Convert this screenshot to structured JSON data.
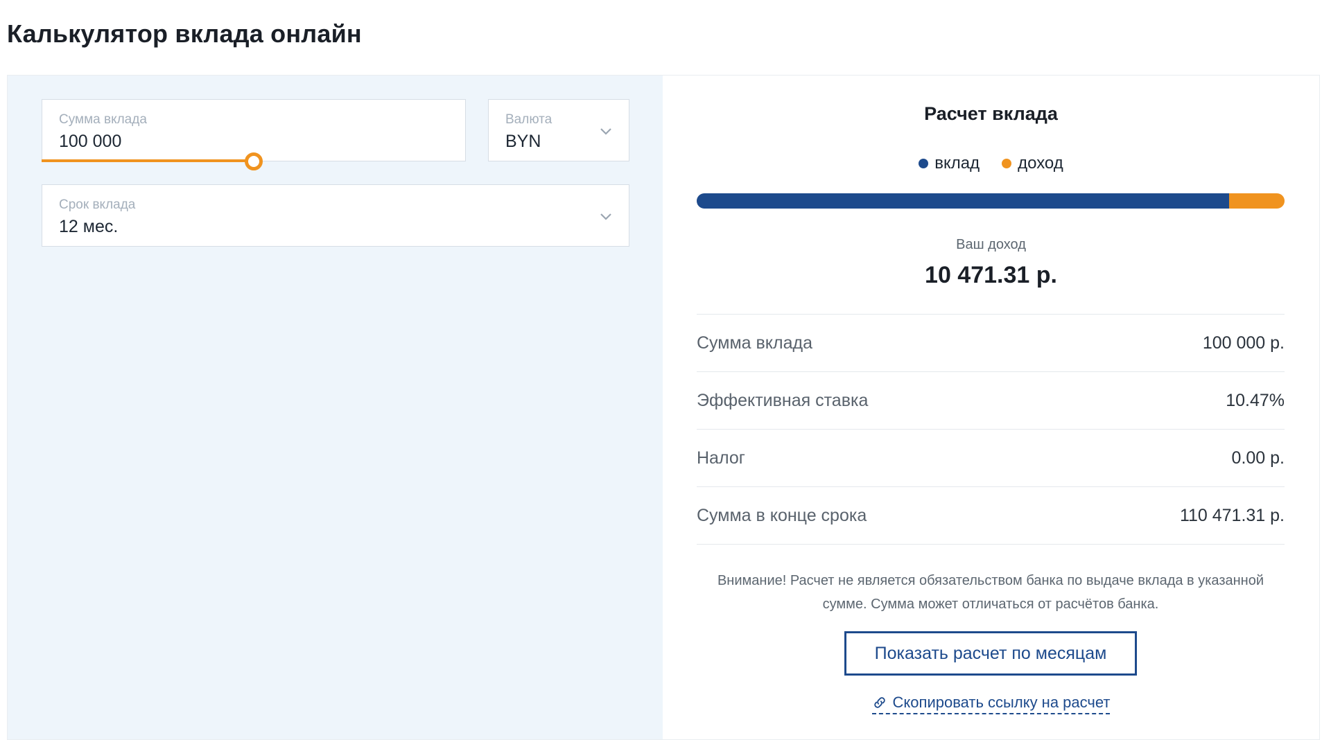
{
  "page": {
    "title": "Калькулятор вклада онлайн"
  },
  "form": {
    "amount": {
      "label": "Сумма вклада",
      "value": "100 000",
      "slider_fraction": 0.5
    },
    "currency": {
      "label": "Валюта",
      "value": "BYN",
      "icon": "chevron-down-icon"
    },
    "term": {
      "label": "Срок вклада",
      "value": "12 мес.",
      "icon": "chevron-down-icon"
    }
  },
  "result": {
    "title": "Расчет вклада",
    "legend": [
      {
        "label": "вклад",
        "color": "#1d4a8c"
      },
      {
        "label": "доход",
        "color": "#f0931f"
      }
    ],
    "bar": {
      "deposit": 100000,
      "income": 10471.31
    },
    "income_label": "Ваш доход",
    "income_value": "10 471.31 р.",
    "rows": [
      {
        "label": "Сумма вклада",
        "value": "100 000 р."
      },
      {
        "label": "Эффективная ставка",
        "value": "10.47%"
      },
      {
        "label": "Налог",
        "value": "0.00 р."
      },
      {
        "label": "Сумма в конце срока",
        "value": "110 471.31 р."
      }
    ],
    "notice": "Внимание! Расчет не является обязательством банка по выдаче вклада в указанной сумме. Сумма может отличаться от расчётов банка.",
    "months_button": "Показать расчет по месяцам",
    "copy_link": {
      "label": "Скопировать ссылку на расчет",
      "icon": "link-icon"
    }
  },
  "colors": {
    "accent": "#f0931f",
    "primary": "#1d4a8c",
    "panel_bg": "#eef5fb"
  }
}
